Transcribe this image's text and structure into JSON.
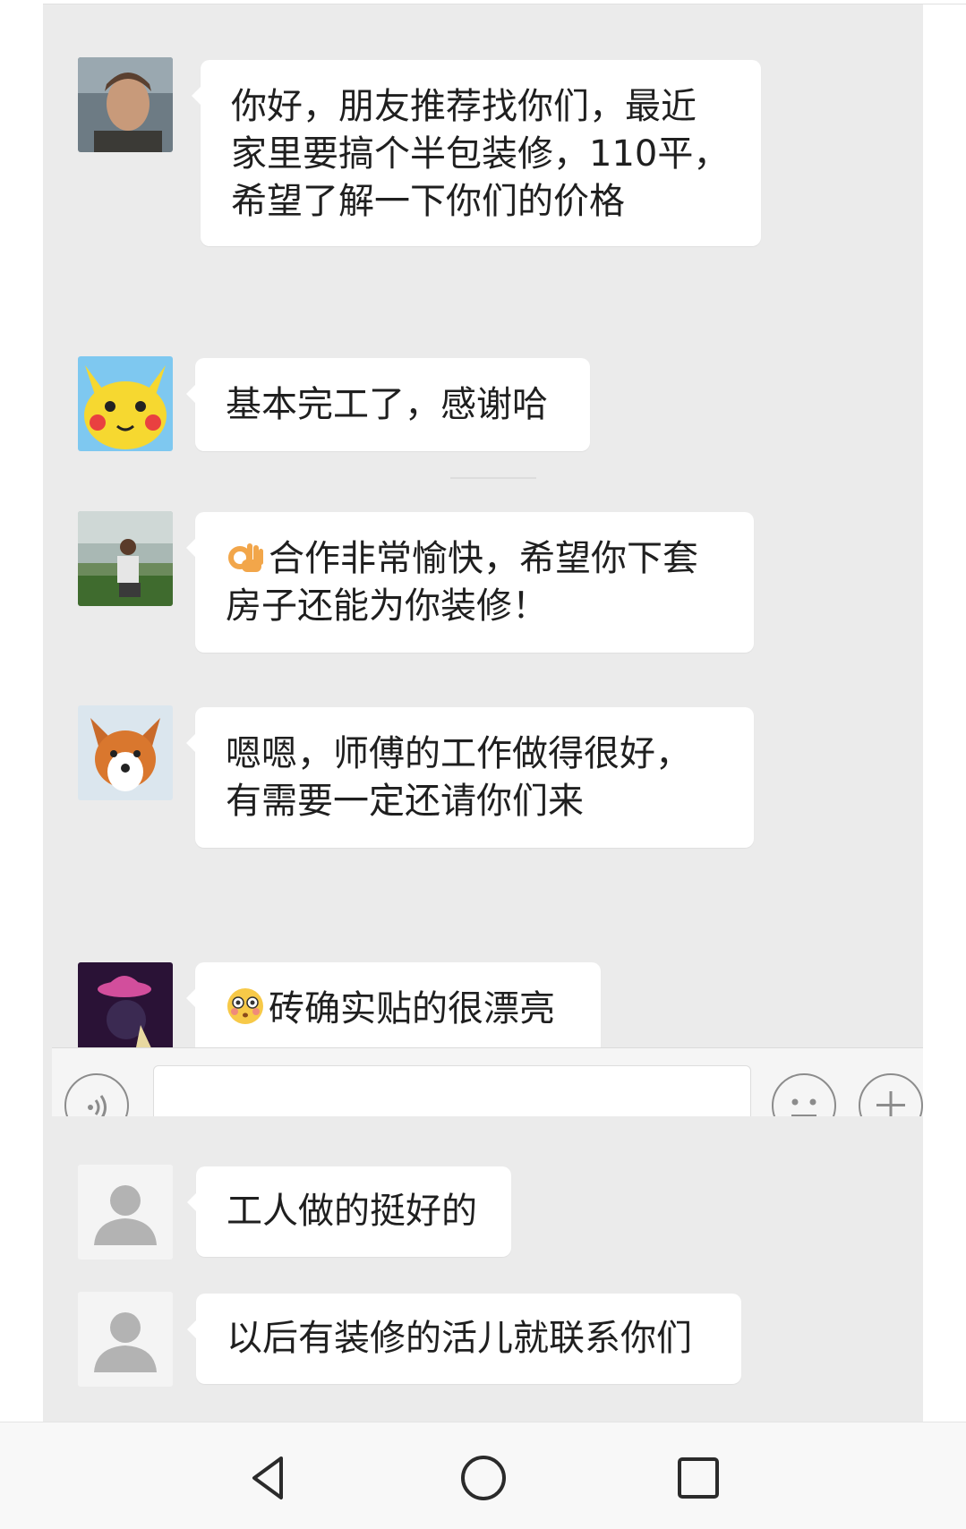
{
  "messages": [
    {
      "avatar_icon": "man-portrait-icon",
      "lines": [
        "你好，朋友推荐找你们，最近",
        "家里要搞个半包装修，110平，",
        "希望了解一下你们的价格"
      ]
    },
    {
      "avatar_icon": "pikachu-avatar-icon",
      "lines": [
        "基本完工了，感谢哈"
      ]
    },
    {
      "avatar_icon": "riverside-man-avatar-icon",
      "emoji": "👌",
      "lines": [
        "合作非常愉快，希望你下套",
        "房子还能为你装修！"
      ]
    },
    {
      "avatar_icon": "fox-avatar-icon",
      "lines": [
        "嗯嗯，师傅的工作做得很好，",
        "有需要一定还请你们来"
      ]
    },
    {
      "avatar_icon": "hat-figure-avatar-icon",
      "emoji": "😳",
      "lines": [
        "砖确实贴的很漂亮"
      ]
    },
    {
      "avatar_icon": "default-user-icon",
      "lines": [
        "工人做的挺好的"
      ]
    },
    {
      "avatar_icon": "default-user-icon",
      "lines": [
        "以后有装修的活儿就联系你们"
      ]
    }
  ],
  "input_bar": {
    "voice_icon": "voice-icon",
    "emoji_icon": "emoji-icon",
    "plus_icon": "plus-icon",
    "message_value": ""
  },
  "nav_bar": {
    "back_icon": "back-triangle-icon",
    "home_icon": "home-circle-icon",
    "recents_icon": "recents-square-icon"
  },
  "colors": {
    "chat_background": "#ebebeb",
    "bubble": "#ffffff",
    "text": "#1f1f1f",
    "nav_background": "#f8f8f8"
  }
}
